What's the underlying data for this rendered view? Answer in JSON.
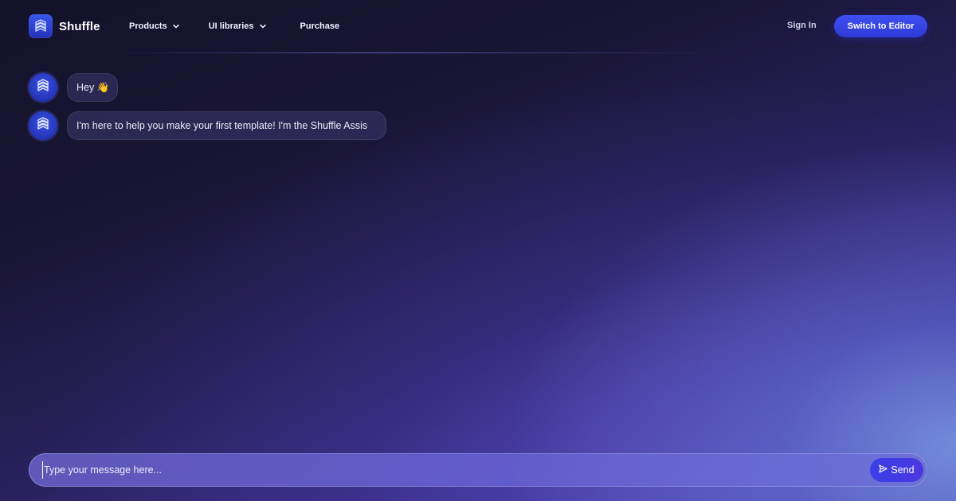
{
  "header": {
    "brand": "Shuffle",
    "logo_icon": "shuffle-logo-icon",
    "nav": [
      {
        "label": "Products",
        "icon": "chevron-down-icon"
      },
      {
        "label": "UI libraries",
        "icon": "chevron-down-icon"
      },
      {
        "label": "Purchase"
      }
    ],
    "sign_in": "Sign In",
    "switch_editor": "Switch to Editor"
  },
  "chat": {
    "avatar_icon": "shuffle-logo-icon",
    "messages": [
      {
        "text": "Hey 👋"
      },
      {
        "text": "I'm here to help you make your first template! I'm the Shuffle Assis"
      }
    ]
  },
  "composer": {
    "placeholder": "Type your message here...",
    "value": "",
    "send_label": "Send",
    "send_icon": "send-icon"
  },
  "colors": {
    "accent": "#3f4ff0",
    "background_dark": "#14122a",
    "background_light": "#6f8fd8"
  }
}
